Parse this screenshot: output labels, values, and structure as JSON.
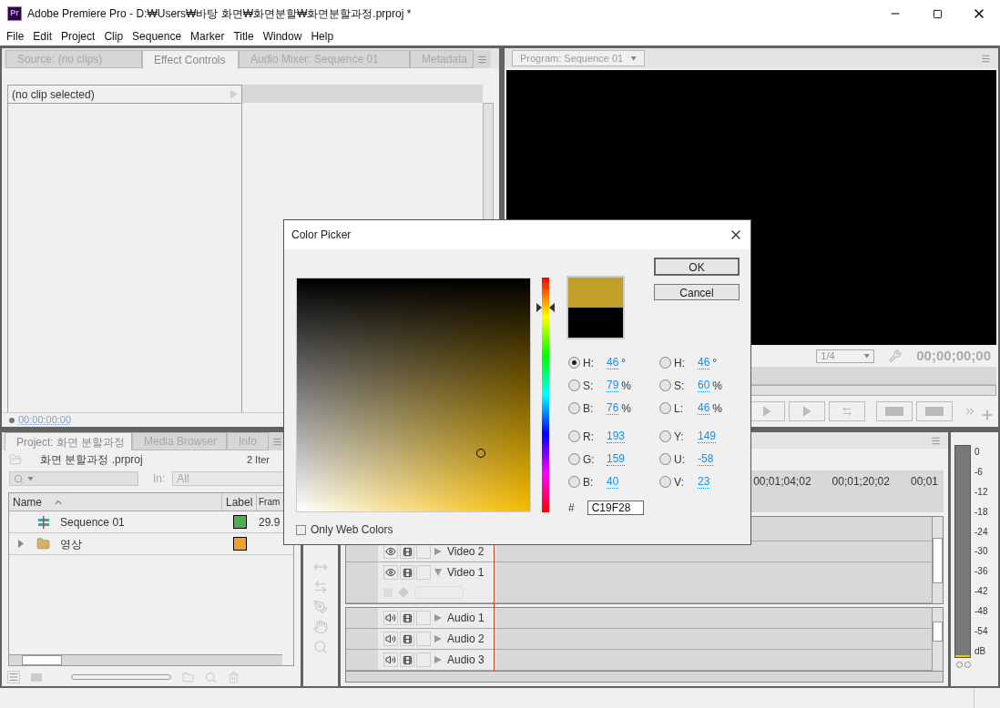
{
  "window": {
    "app_icon": "Pr",
    "title": "Adobe Premiere Pro - D:₩Users₩바탕 화면₩화면분할₩화면분할과정.prproj *"
  },
  "menu": [
    "File",
    "Edit",
    "Project",
    "Clip",
    "Sequence",
    "Marker",
    "Title",
    "Window",
    "Help"
  ],
  "source_panel": {
    "tabs": [
      {
        "label": "Source: (no clips)",
        "selected": false
      },
      {
        "label": "Effect Controls",
        "selected": true
      },
      {
        "label": "Audio Mixer: Sequence 01",
        "selected": false
      },
      {
        "label": "Metadata",
        "selected": false
      }
    ],
    "clip_header": "(no clip selected)",
    "timecode": "00:00:00:00"
  },
  "program_panel": {
    "tab": "Program: Sequence 01",
    "zoom": "1/4",
    "timecode": "00;00;00;00"
  },
  "project_panel": {
    "tabs": [
      {
        "label": "Project: 화면 분할과정",
        "selected": true
      },
      {
        "label": "Media Browser",
        "selected": false
      },
      {
        "label": "Info",
        "selected": false
      }
    ],
    "file": "화면 분할과정 .prproj",
    "item_count": "2 Iter",
    "in_label": "In:",
    "in_value": "All",
    "columns": [
      "Name",
      "Label",
      "Fram"
    ],
    "rows": [
      {
        "kind": "sequence",
        "name": "Sequence 01",
        "color": "#4caf50",
        "frame_rate": "29.9"
      },
      {
        "kind": "bin",
        "name": "영상",
        "color": "#f0a030"
      }
    ]
  },
  "timeline": {
    "ruler": [
      "00;01;04;02",
      "00;01;20;02",
      "00;01"
    ],
    "tracks": [
      {
        "kind": "video",
        "name": "Video 2",
        "expanded": false
      },
      {
        "kind": "video",
        "name": "Video 1",
        "expanded": true
      },
      {
        "kind": "audio",
        "name": "Audio 1",
        "expanded": false
      },
      {
        "kind": "audio",
        "name": "Audio 2",
        "expanded": false
      },
      {
        "kind": "audio",
        "name": "Audio 3",
        "expanded": false
      }
    ]
  },
  "meter": {
    "scale": [
      "0",
      "-6",
      "-12",
      "-18",
      "-24",
      "-30",
      "-36",
      "-42",
      "-48",
      "-54",
      "dB"
    ]
  },
  "color_picker": {
    "title": "Color Picker",
    "ok": "OK",
    "cancel": "Cancel",
    "fields_left": [
      {
        "label": "H:",
        "value": "46",
        "unit": "°",
        "selected": true
      },
      {
        "label": "S:",
        "value": "79",
        "unit": "%",
        "selected": false
      },
      {
        "label": "B:",
        "value": "76",
        "unit": "%",
        "selected": false
      },
      {
        "label": "R:",
        "value": "193",
        "selected": false
      },
      {
        "label": "G:",
        "value": "159",
        "selected": false
      },
      {
        "label": "B:",
        "value": "40",
        "selected": false
      }
    ],
    "fields_right": [
      {
        "label": "H:",
        "value": "46",
        "unit": "°",
        "selected": false
      },
      {
        "label": "S:",
        "value": "60",
        "unit": "%",
        "selected": false
      },
      {
        "label": "L:",
        "value": "46",
        "unit": "%",
        "selected": false
      },
      {
        "label": "Y:",
        "value": "149",
        "selected": false
      },
      {
        "label": "U:",
        "value": "-58",
        "selected": false
      },
      {
        "label": "V:",
        "value": "23",
        "selected": false
      }
    ],
    "hash": "#",
    "hex": "C19F28",
    "web_colors": {
      "label": "Only Web Colors",
      "checked": false
    }
  }
}
